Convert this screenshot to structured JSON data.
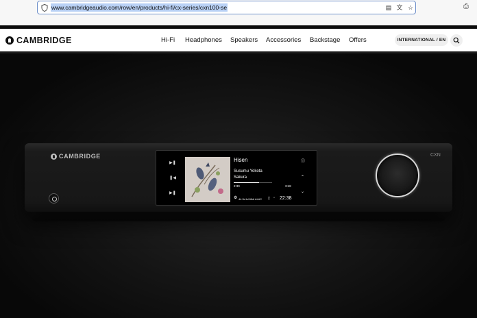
{
  "browser": {
    "url": "www.cambridgeaudio.com/row/en/products/hi-fi/cx-series/cxn100-se",
    "icons": [
      "shield-icon",
      "reader-icon",
      "translate-icon",
      "bookmark-star-icon",
      "print-icon"
    ]
  },
  "site": {
    "brand": "CAMBRIDGE",
    "nav": [
      "Hi-Fi",
      "Headphones",
      "Speakers",
      "Accessories",
      "Backstage",
      "Offers"
    ],
    "locale_button": "INTERNATIONAL / EN",
    "search_icon": "search-icon"
  },
  "device": {
    "brand": "CAMBRIDGE",
    "model": "CXN",
    "screen": {
      "title": "Hisen",
      "artist": "Susumu Yokota",
      "album": "Sakura",
      "elapsed": "2:30",
      "total": "3:48",
      "progress": 0.66,
      "format": "44.1kHz/16bit ALAC",
      "clock": "22:38"
    }
  },
  "colors": {
    "accent_url_highlight": "#b9d1f5",
    "page_background": "#ffffff",
    "hero_background": "#111111"
  }
}
